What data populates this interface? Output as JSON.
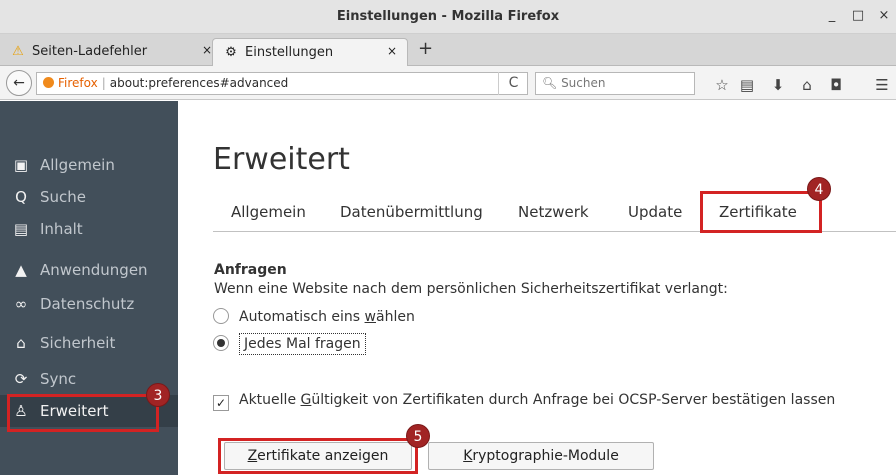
{
  "window": {
    "title": "Einstellungen - Mozilla Firefox",
    "controls": {
      "minimize": "_",
      "maximize": "□",
      "close": "×"
    }
  },
  "tabs": [
    {
      "label": "Seiten-Ladefehler",
      "icon": "warning-icon",
      "close": "×"
    },
    {
      "label": "Einstellungen",
      "icon": "gear-icon",
      "close": "×"
    }
  ],
  "new_tab_label": "+",
  "navbar": {
    "back": "←",
    "identity": "Firefox",
    "separator": "|",
    "url": "about:preferences#advanced",
    "reload": "C",
    "search_placeholder": "Suchen",
    "toolbar_icons": [
      "star-icon",
      "reading-list-icon",
      "download-icon",
      "home-icon",
      "pocket-icon",
      "menu-icon"
    ]
  },
  "sidebar": {
    "items": [
      {
        "label": "Allgemein",
        "icon": "general-icon"
      },
      {
        "label": "Suche",
        "icon": "search-icon"
      },
      {
        "label": "Inhalt",
        "icon": "document-icon"
      },
      {
        "label": "Anwendungen",
        "icon": "applications-icon"
      },
      {
        "label": "Datenschutz",
        "icon": "mask-icon"
      },
      {
        "label": "Sicherheit",
        "icon": "lock-icon"
      },
      {
        "label": "Sync",
        "icon": "sync-icon"
      },
      {
        "label": "Erweitert",
        "icon": "advanced-icon",
        "selected": true
      }
    ]
  },
  "main": {
    "title": "Erweitert",
    "tabs": [
      "Allgemein",
      "Datenübermittlung",
      "Netzwerk",
      "Update",
      "Zertifikate"
    ],
    "selected_tab": "Zertifikate",
    "section": {
      "heading": "Anfragen",
      "description": "Wenn eine Website nach dem persönlichen Sicherheitszertifikat verlangt:",
      "options": [
        {
          "pre": "Automatisch eins ",
          "key": "w",
          "post": "ählen",
          "checked": false
        },
        {
          "pre": "",
          "key": "J",
          "post": "edes Mal fragen",
          "checked": true
        }
      ],
      "ocsp": {
        "pre": "Aktuelle ",
        "key": "G",
        "post": "ültigkeit von Zertifikaten durch Anfrage bei OCSP-Server bestätigen lassen",
        "checked": true,
        "mark": "✓"
      }
    },
    "buttons": {
      "view_certs": {
        "key": "Z",
        "rest": "ertifikate anzeigen"
      },
      "crypto_modules": {
        "key": "K",
        "rest": "ryptographie-Module"
      }
    }
  },
  "annotations": {
    "badge_sidebar": "3",
    "badge_tab": "4",
    "badge_button": "5",
    "highlight_color": "#d32323"
  }
}
